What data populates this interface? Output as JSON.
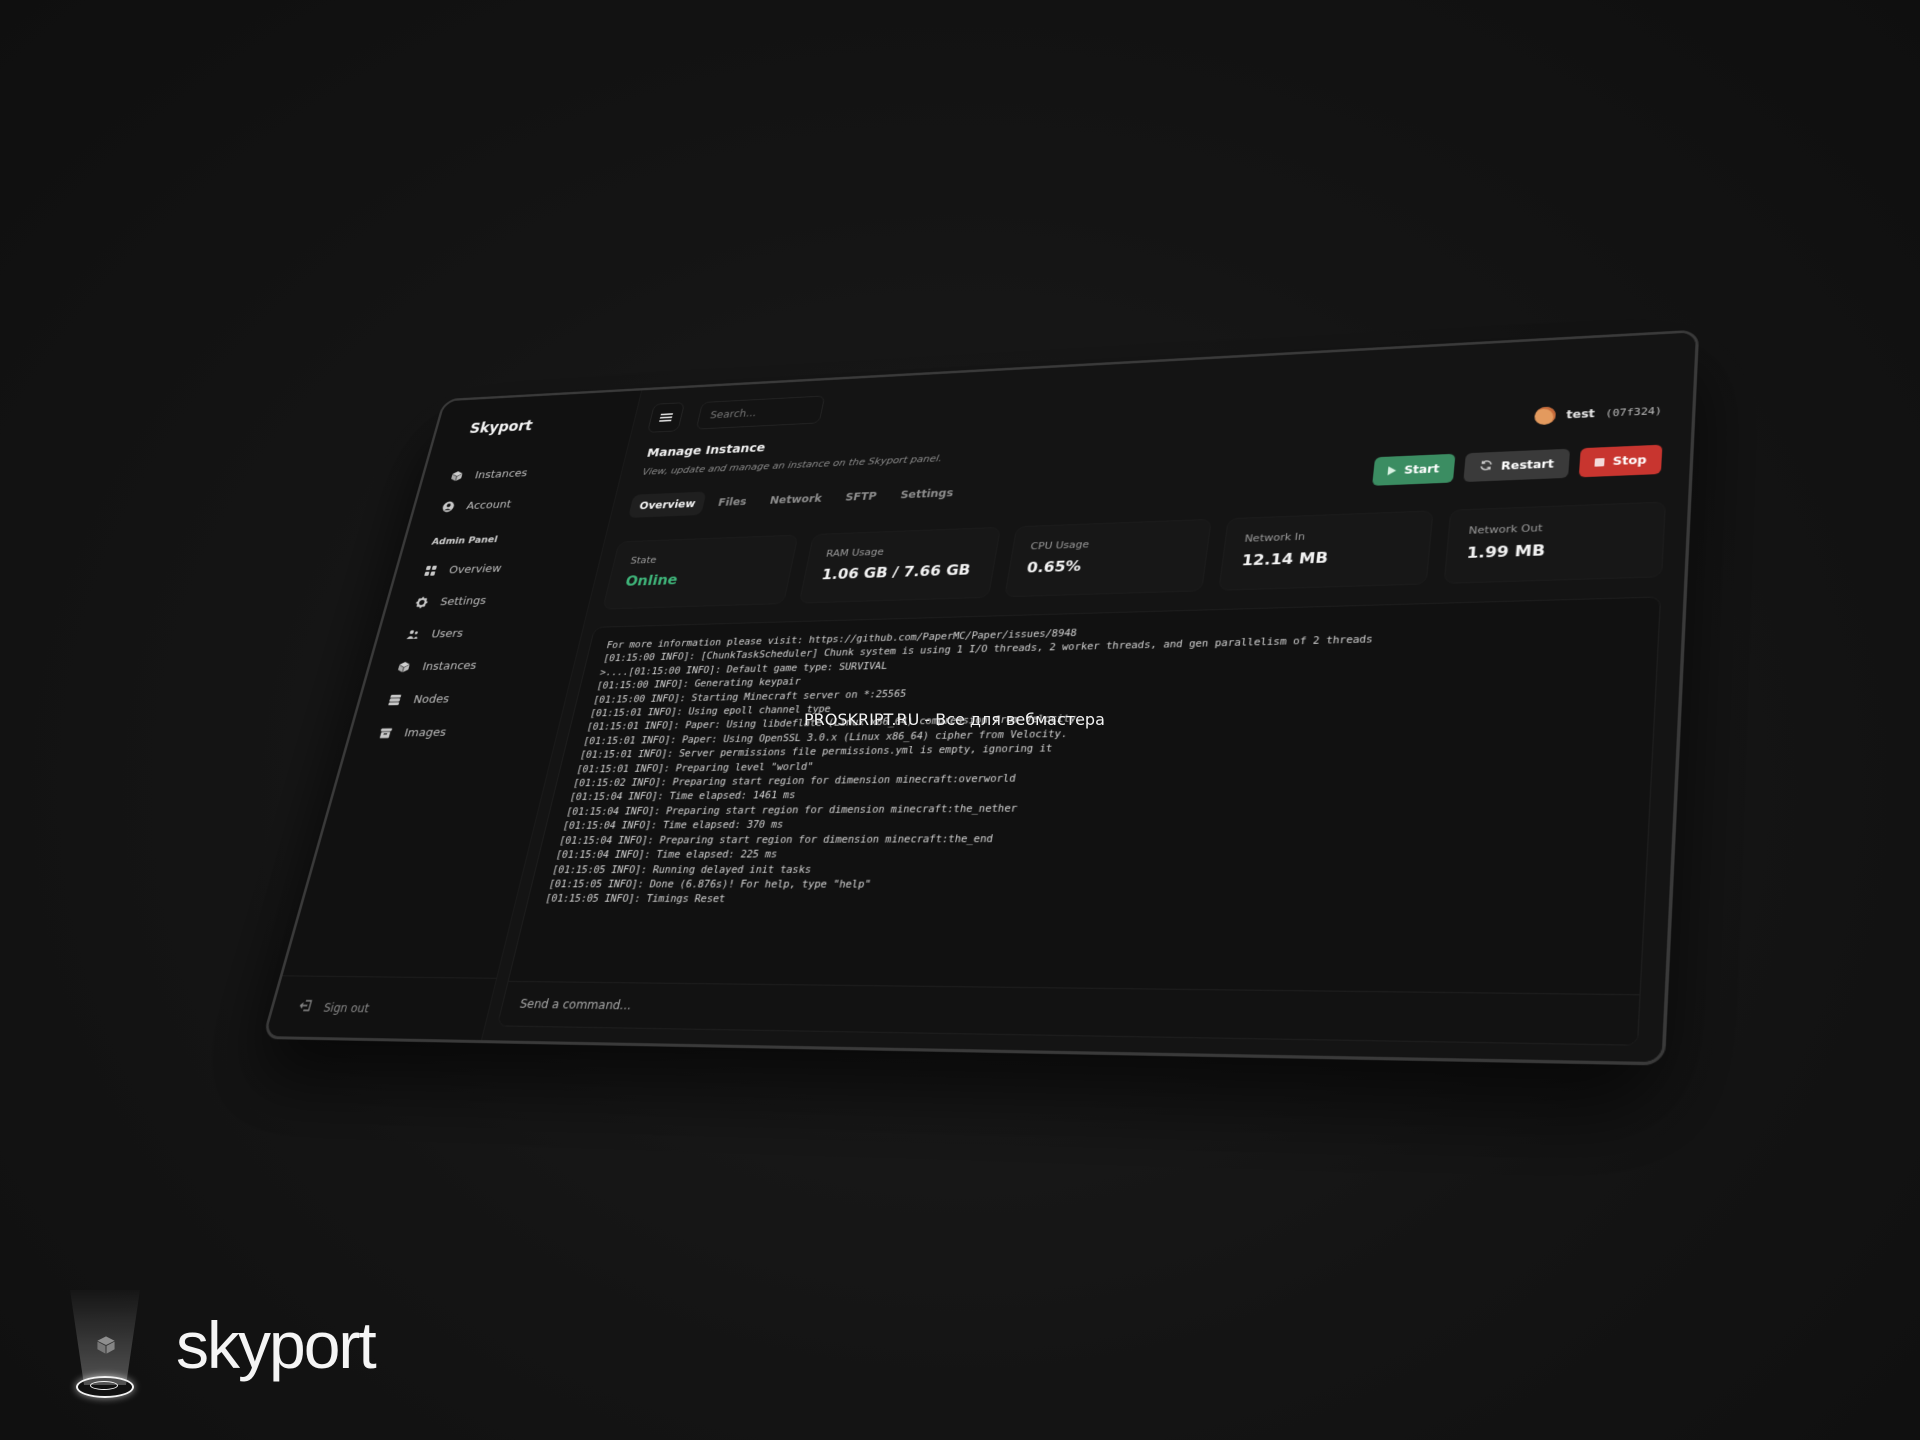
{
  "sidebar": {
    "brand": "Skyport",
    "items": [
      {
        "label": "Instances",
        "icon": "cube-icon"
      },
      {
        "label": "Account",
        "icon": "user-circle-icon"
      }
    ],
    "admin_section": "Admin Panel",
    "admin_items": [
      {
        "label": "Overview",
        "icon": "grid-icon"
      },
      {
        "label": "Settings",
        "icon": "gear-icon"
      },
      {
        "label": "Users",
        "icon": "users-icon"
      },
      {
        "label": "Instances",
        "icon": "cube-icon"
      },
      {
        "label": "Nodes",
        "icon": "server-icon"
      },
      {
        "label": "Images",
        "icon": "archive-icon"
      }
    ],
    "sign_out": "Sign out"
  },
  "topbar": {
    "search_placeholder": "Search..."
  },
  "header": {
    "title": "Manage Instance",
    "subtitle": "View, update and manage an instance on the Skyport panel."
  },
  "user": {
    "name": "test",
    "id": "(07f324)"
  },
  "tabs": [
    "Overview",
    "Files",
    "Network",
    "SFTP",
    "Settings"
  ],
  "active_tab": "Overview",
  "actions": {
    "start": "Start",
    "restart": "Restart",
    "stop": "Stop"
  },
  "colors": {
    "start": "#3b8d62",
    "restart": "#3a3a3a",
    "stop": "#c8352f",
    "online": "#3fb57a"
  },
  "stats": [
    {
      "label": "State",
      "value": "Online"
    },
    {
      "label": "RAM Usage",
      "value": "1.06 GB / 7.66 GB"
    },
    {
      "label": "CPU Usage",
      "value": "0.65%"
    },
    {
      "label": "Network In",
      "value": "12.14 MB"
    },
    {
      "label": "Network Out",
      "value": "1.99 MB"
    }
  ],
  "console": {
    "lines": [
      "For more information please visit: https://github.com/PaperMC/Paper/issues/8948",
      "[01:15:00 INFO]: [ChunkTaskScheduler] Chunk system is using 1 I/O threads, 2 worker threads, and gen parallelism of 2 threads",
      ">....[01:15:00 INFO]: Default game type: SURVIVAL",
      "[01:15:00 INFO]: Generating keypair",
      "[01:15:00 INFO]: Starting Minecraft server on *:25565",
      "[01:15:01 INFO]: Using epoll channel type",
      "[01:15:01 INFO]: Paper: Using libdeflate (Linux x86_64) compression from Velocity.",
      "[01:15:01 INFO]: Paper: Using OpenSSL 3.0.x (Linux x86_64) cipher from Velocity.",
      "[01:15:01 INFO]: Server permissions file permissions.yml is empty, ignoring it",
      "[01:15:01 INFO]: Preparing level \"world\"",
      "[01:15:02 INFO]: Preparing start region for dimension minecraft:overworld",
      "[01:15:04 INFO]: Time elapsed: 1461 ms",
      "[01:15:04 INFO]: Preparing start region for dimension minecraft:the_nether",
      "[01:15:04 INFO]: Time elapsed: 370 ms",
      "[01:15:04 INFO]: Preparing start region for dimension minecraft:the_end",
      "[01:15:04 INFO]: Time elapsed: 225 ms",
      "[01:15:05 INFO]: Running delayed init tasks",
      "[01:15:05 INFO]: Done (6.876s)! For help, type \"help\"",
      "[01:15:05 INFO]: Timings Reset"
    ],
    "command_placeholder": "Send a command..."
  },
  "watermark": "PROSKRIPT.RU - Все для вебмастера",
  "logo_text": "skyport"
}
